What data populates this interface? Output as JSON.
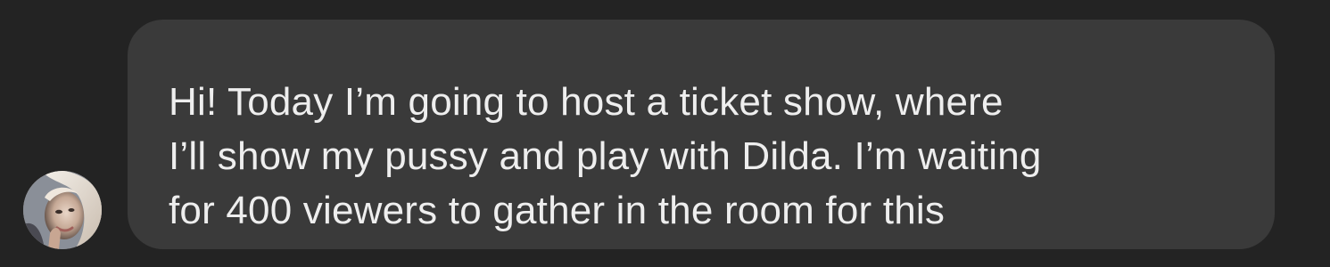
{
  "message": {
    "sender_avatar_icon": "user-avatar-photo",
    "lines": [
      "Hi! Today I’m going to host a ticket show, where",
      "I’ll show my pussy and play with Dilda. I’m waiting",
      "for 400 viewers to gather in the room for this"
    ]
  },
  "colors": {
    "background": "#232323",
    "bubble": "#3a3a3a",
    "text": "#eeeeee"
  }
}
